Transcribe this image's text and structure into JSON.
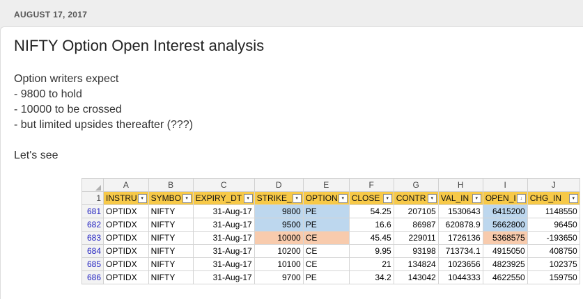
{
  "post": {
    "date": "AUGUST 17, 2017",
    "title": "NIFTY Option Open Interest analysis",
    "lines": [
      "Option writers expect",
      "- 9800 to hold",
      "- 10000 to be crossed",
      "- but limited upsides thereafter (???)",
      "",
      "Let's see"
    ]
  },
  "sheet": {
    "column_letters": [
      "A",
      "B",
      "C",
      "D",
      "E",
      "F",
      "G",
      "H",
      "I",
      "J"
    ],
    "header_row_number": "1",
    "headers": [
      "INSTRU",
      "SYMBO",
      "EXPIRY_DT",
      "STRIKE_",
      "OPTION",
      "CLOSE",
      "CONTR",
      "VAL_IN",
      "OPEN_I",
      "CHG_IN"
    ],
    "filter_glyphs": [
      "▾",
      "▾",
      "▾",
      "▾",
      "▾",
      "▾",
      "▾",
      "▾",
      "↓",
      "▾"
    ],
    "rows": [
      {
        "num": "681",
        "cells": [
          "OPTIDX",
          "NIFTY",
          "31-Aug-17",
          "9800",
          "PE",
          "54.25",
          "207105",
          "1530643",
          "6415200",
          "1148550"
        ]
      },
      {
        "num": "682",
        "cells": [
          "OPTIDX",
          "NIFTY",
          "31-Aug-17",
          "9500",
          "PE",
          "16.6",
          "86987",
          "620878.9",
          "5662800",
          "96450"
        ]
      },
      {
        "num": "683",
        "cells": [
          "OPTIDX",
          "NIFTY",
          "31-Aug-17",
          "10000",
          "CE",
          "45.45",
          "229011",
          "1726136",
          "5368575",
          "-193650"
        ]
      },
      {
        "num": "684",
        "cells": [
          "OPTIDX",
          "NIFTY",
          "31-Aug-17",
          "10200",
          "CE",
          "9.95",
          "93198",
          "713734.1",
          "4915050",
          "408750"
        ]
      },
      {
        "num": "685",
        "cells": [
          "OPTIDX",
          "NIFTY",
          "31-Aug-17",
          "10100",
          "CE",
          "21",
          "134824",
          "1023656",
          "4823925",
          "102375"
        ]
      },
      {
        "num": "686",
        "cells": [
          "OPTIDX",
          "NIFTY",
          "31-Aug-17",
          "9700",
          "PE",
          "34.2",
          "143042",
          "1044333",
          "4622550",
          "159750"
        ]
      }
    ],
    "highlights": {
      "blue": "#bdd7ee",
      "peach": "#f8cbad",
      "header": "#f7c948"
    }
  }
}
